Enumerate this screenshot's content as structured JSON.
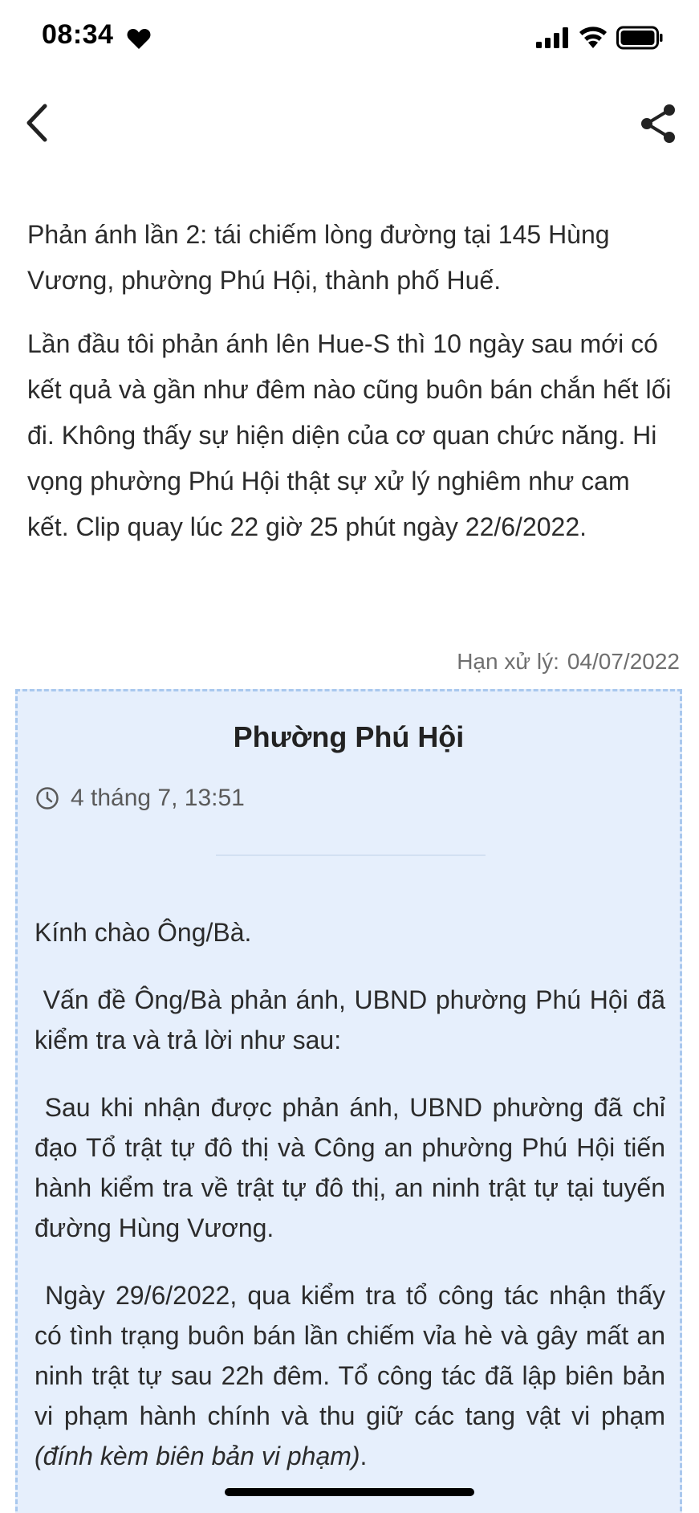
{
  "status_bar": {
    "time": "08:34",
    "icons": [
      "heart-icon",
      "signal-icon",
      "wifi-icon",
      "battery-icon"
    ]
  },
  "nav": {
    "back_icon": "chevron-left-icon",
    "share_icon": "share-icon"
  },
  "report": {
    "title": "Phản ánh lần 2: tái chiếm lòng đường tại 145 Hùng Vương, phường Phú Hội, thành phố Huế.",
    "body": "Lần đầu tôi phản ánh lên Hue-S thì 10 ngày sau mới có kết quả và gần như đêm nào cũng buôn bán chắn hết lối đi. Không thấy sự hiện diện của cơ quan chức năng. Hi vọng phường Phú Hội thật sự xử lý nghiêm như cam kết. Clip quay lúc 22 giờ 25 phút ngày 22/6/2022."
  },
  "deadline": {
    "label": "Hạn xử lý:",
    "value": "04/07/2022"
  },
  "response": {
    "responder": "Phường Phú Hội",
    "time": "4 tháng 7, 13:51",
    "greeting": "Kính chào Ông/Bà.",
    "para1": " Vấn đề Ông/Bà phản ánh, UBND phường Phú Hội đã kiểm tra và trả lời như sau:",
    "para2": " Sau khi nhận được phản ánh, UBND phường đã chỉ đạo Tổ trật tự đô thị và Công an phường Phú Hội tiến hành kiểm tra về trật tự đô thị, an ninh trật tự tại tuyến đường Hùng Vương.",
    "para3": " Ngày 29/6/2022, qua kiểm tra tổ công tác nhận thấy có tình trạng buôn bán lần chiếm vỉa hè và gây mất an ninh trật tự sau 22h đêm. Tổ công tác đã lập biên bản vi phạm hành chính và thu giữ các tang vật vi phạm ",
    "para3_italic": "(đính kèm biên bản vi phạm)",
    "para3_end": "."
  },
  "colors": {
    "card_background": "#e6effc",
    "card_border": "#a9c8ee",
    "deadline_text": "#6f6f6f"
  }
}
